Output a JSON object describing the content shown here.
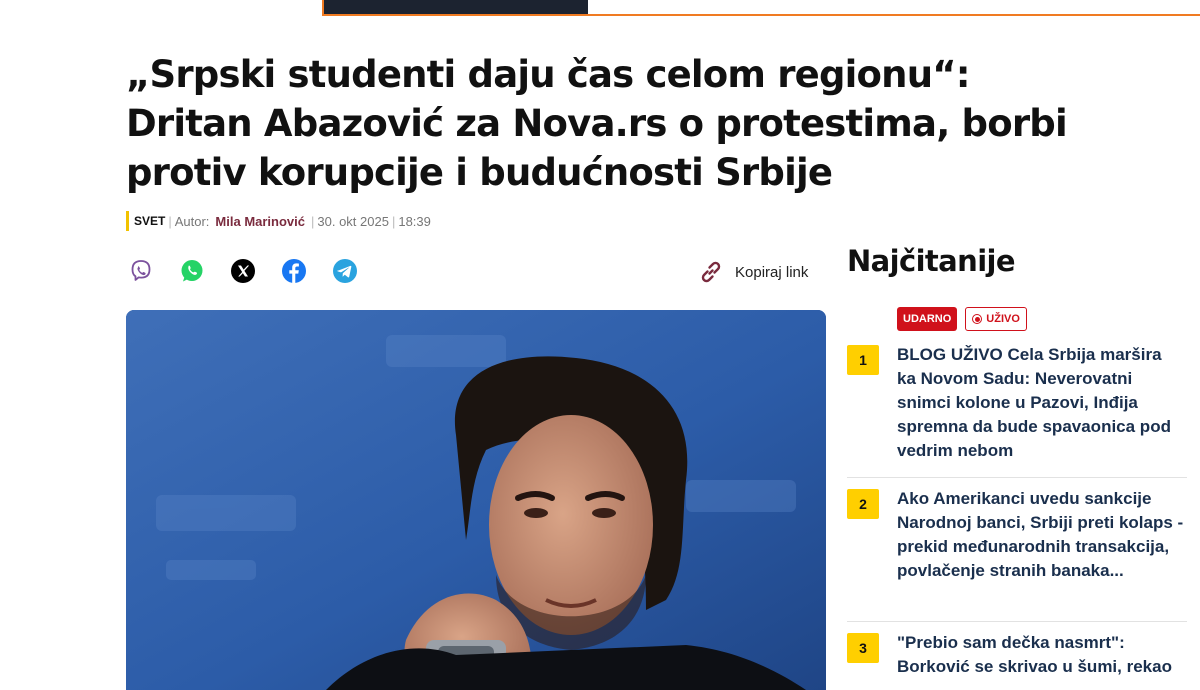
{
  "article": {
    "headline": "„Srpski studenti daju čas celom regionu“: Dritan Abazović za Nova.rs o protestima, borbi protiv korupcije i budućnosti Srbije",
    "category": "SVET",
    "author_label": "Autor:",
    "author": "Mila Marinović",
    "date": "30. okt 2025",
    "time": "18:39",
    "copy_link_label": "Kopiraj link",
    "hero_image_alt": ""
  },
  "share_icons": [
    "viber-icon",
    "whatsapp-icon",
    "x-icon",
    "facebook-icon",
    "telegram-icon"
  ],
  "sidebar": {
    "title": "Najčitanije",
    "badge_udarno": "UDARNO",
    "badge_uzivo": "UŽIVO",
    "items": [
      {
        "rank": "1",
        "text": "BLOG UŽIVO Cela Srbija maršira ka Novom Sadu: Neverovatni snimci kolone u Pazovi, Inđija spremna da bude spavaonica pod vedrim nebom"
      },
      {
        "rank": "2",
        "text": "Ako Amerikanci uvedu sankcije Narodnoj banci, Srbiji preti kolaps - prekid međunarodnih transakcija, povlačenje stranih banaka..."
      },
      {
        "rank": "3",
        "text": "\"Prebio sam dečka nasmrt\": Borković se skrivao u šumi, rekao"
      }
    ]
  },
  "colors": {
    "accent_orange": "#f07b22",
    "category_bar": "#f2c200",
    "author_color": "#7a2b3e",
    "rank_badge": "#ffcf00",
    "live_red": "#d0111b",
    "link_color": "#1a2f4d"
  }
}
